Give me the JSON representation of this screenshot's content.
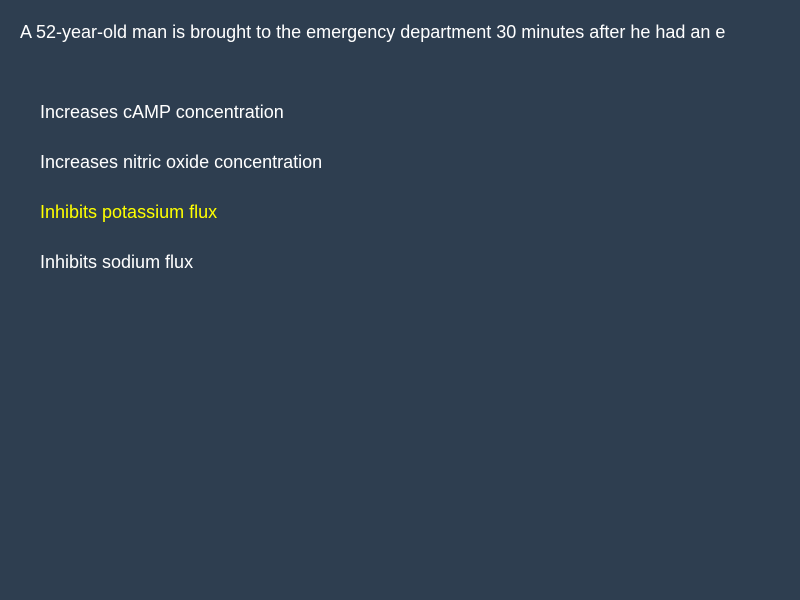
{
  "question": {
    "text": "A 52-year-old man is brought to the emergency department 30 minutes after he had an e"
  },
  "options": [
    {
      "label": "Increases cAMP concentration",
      "selected": false
    },
    {
      "label": "Increases nitric oxide concentration",
      "selected": false
    },
    {
      "label": "Inhibits potassium flux",
      "selected": true
    },
    {
      "label": "Inhibits sodium flux",
      "selected": false
    }
  ],
  "colors": {
    "background": "#2e3e50",
    "text": "#ffffff",
    "highlight": "#ffff00"
  }
}
